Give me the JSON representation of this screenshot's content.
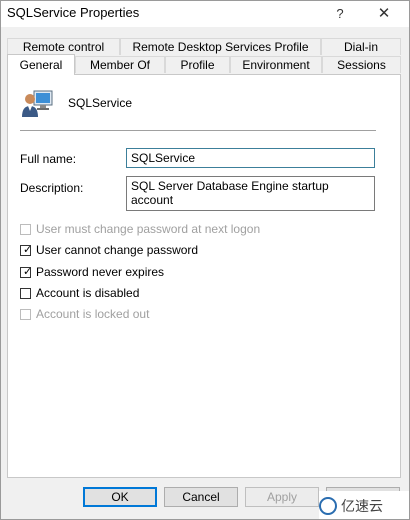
{
  "window": {
    "title": "SQLService Properties",
    "help_glyph": "?",
    "close_glyph": "✕"
  },
  "tabs": {
    "back_row": [
      "Remote control",
      "Remote Desktop Services Profile",
      "Dial-in"
    ],
    "front_row": [
      "General",
      "Member Of",
      "Profile",
      "Environment",
      "Sessions"
    ],
    "active": "General"
  },
  "general": {
    "user_icon": "user-computer-icon",
    "display_name": "SQLService",
    "full_name_label": "Full name:",
    "full_name_value": "SQLService",
    "description_label": "Description:",
    "description_value": "SQL Server Database Engine startup account"
  },
  "options": [
    {
      "label": "User must change password at next logon",
      "checked": false,
      "enabled": false
    },
    {
      "label": "User cannot change password",
      "checked": true,
      "enabled": true
    },
    {
      "label": "Password never expires",
      "checked": true,
      "enabled": true
    },
    {
      "label": "Account is disabled",
      "checked": false,
      "enabled": true
    },
    {
      "label": "Account is locked out",
      "checked": false,
      "enabled": false
    }
  ],
  "buttons": {
    "ok": "OK",
    "cancel": "Cancel",
    "apply": "Apply",
    "help": "Help"
  },
  "watermark": {
    "text": "亿速云"
  },
  "colors": {
    "focus_border": "#3c7f9a",
    "default_button_border": "#0078d7",
    "disabled_text": "#a0a0a0"
  }
}
